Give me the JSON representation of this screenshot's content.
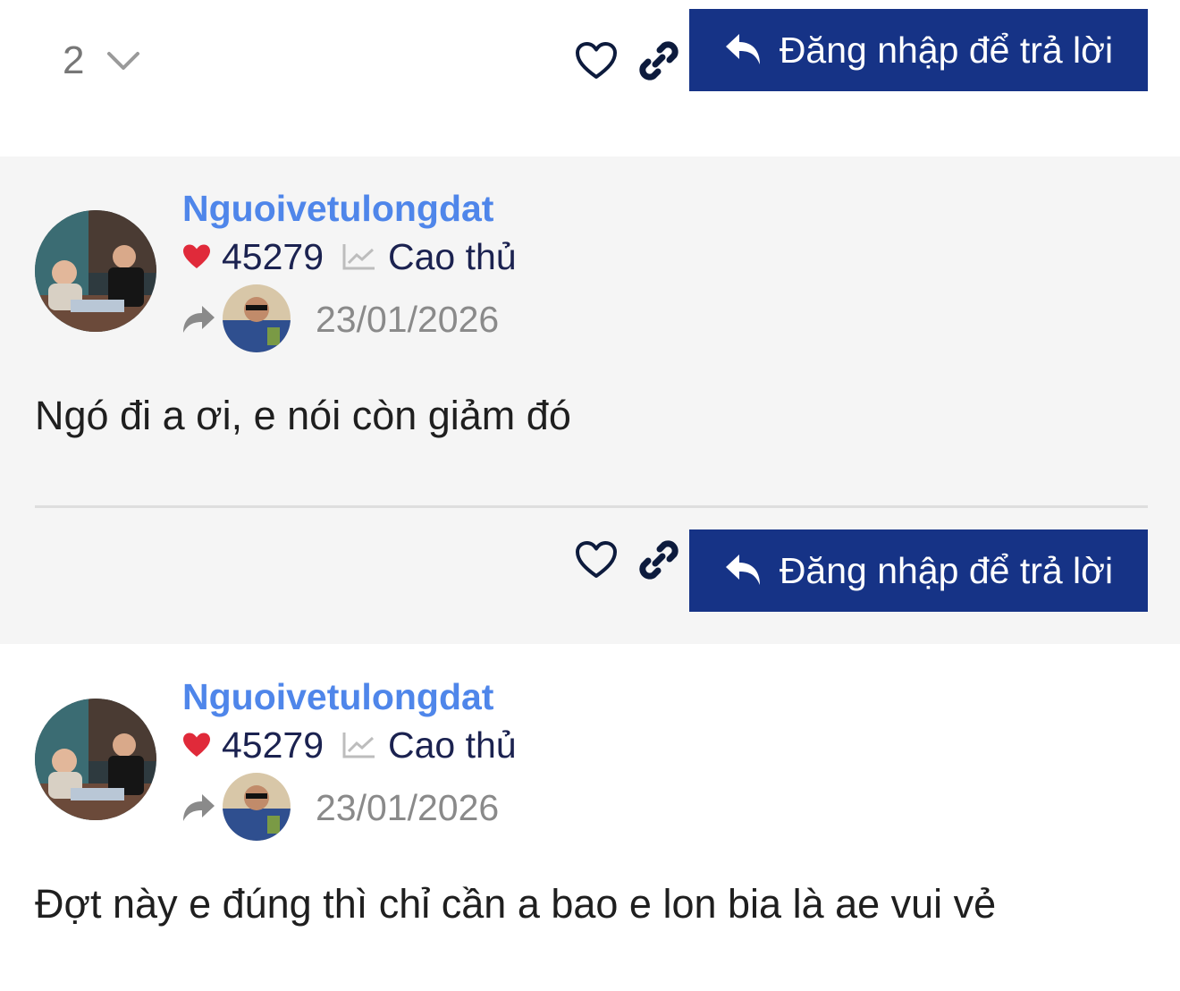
{
  "pagination": {
    "current_page": "2"
  },
  "action_bar": {
    "reply_label": "Đăng nhập để trả lời"
  },
  "posts": [
    {
      "username": "Nguoivetulongdat",
      "reputation": "45279",
      "rank": "Cao thủ",
      "date": "23/01/2026",
      "body": "Ngó đi a ơi, e nói còn giảm đó",
      "reply_label": "Đăng nhập để trả lời"
    },
    {
      "username": "Nguoivetulongdat",
      "reputation": "45279",
      "rank": "Cao thủ",
      "date": "23/01/2026",
      "body": "Đợt này e đúng thì chỉ cần a bao e lon bia là ae vui vẻ"
    }
  ],
  "icons": {
    "heart_outline": "heart-outline-icon",
    "link": "link-icon",
    "reply": "reply-arrow-icon",
    "reputation": "heart-filled-icon",
    "rank": "trend-chart-icon",
    "quote": "share-arrow-icon",
    "chevron": "chevron-down-icon"
  },
  "colors": {
    "button_bg": "#163386",
    "username": "#4f86ea",
    "reputation_heart": "#e02a3a",
    "date": "#8a8a8a",
    "post_bg": "#f5f5f5"
  }
}
